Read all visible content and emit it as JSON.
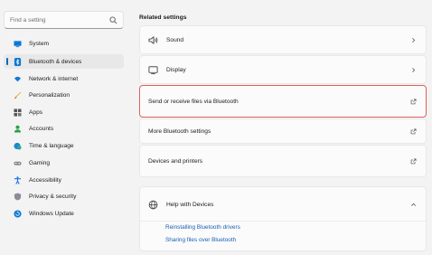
{
  "search": {
    "placeholder": "Find a setting"
  },
  "sidebar": {
    "items": [
      {
        "label": "System",
        "icon": "monitor-icon"
      },
      {
        "label": "Bluetooth & devices",
        "icon": "bluetooth-icon",
        "selected": true
      },
      {
        "label": "Network & internet",
        "icon": "wifi-icon"
      },
      {
        "label": "Personalization",
        "icon": "brush-icon"
      },
      {
        "label": "Apps",
        "icon": "apps-icon"
      },
      {
        "label": "Accounts",
        "icon": "person-icon"
      },
      {
        "label": "Time & language",
        "icon": "globe-clock-icon"
      },
      {
        "label": "Gaming",
        "icon": "gamepad-icon"
      },
      {
        "label": "Accessibility",
        "icon": "accessibility-icon"
      },
      {
        "label": "Privacy & security",
        "icon": "shield-icon"
      },
      {
        "label": "Windows Update",
        "icon": "update-icon"
      }
    ]
  },
  "main": {
    "section_title": "Related settings",
    "rows": [
      {
        "label": "Sound",
        "icon": "speaker-icon",
        "trail": "chevron-right-icon"
      },
      {
        "label": "Display",
        "icon": "display-icon",
        "trail": "chevron-right-icon"
      },
      {
        "label": "Send or receive files via Bluetooth",
        "trail": "external-link-icon",
        "highlighted": true
      },
      {
        "label": "More Bluetooth settings",
        "trail": "external-link-icon"
      },
      {
        "label": "Devices and printers",
        "trail": "external-link-icon"
      }
    ],
    "help": {
      "title": "Help with Devices",
      "icon": "globe-icon",
      "trail": "chevron-up-icon",
      "links": [
        "Reinstalling Bluetooth drivers",
        "Sharing files over Bluetooth"
      ]
    }
  },
  "colors": {
    "accent": "#0067c0",
    "link": "#1a5fb4",
    "highlight_border": "#e06060"
  }
}
